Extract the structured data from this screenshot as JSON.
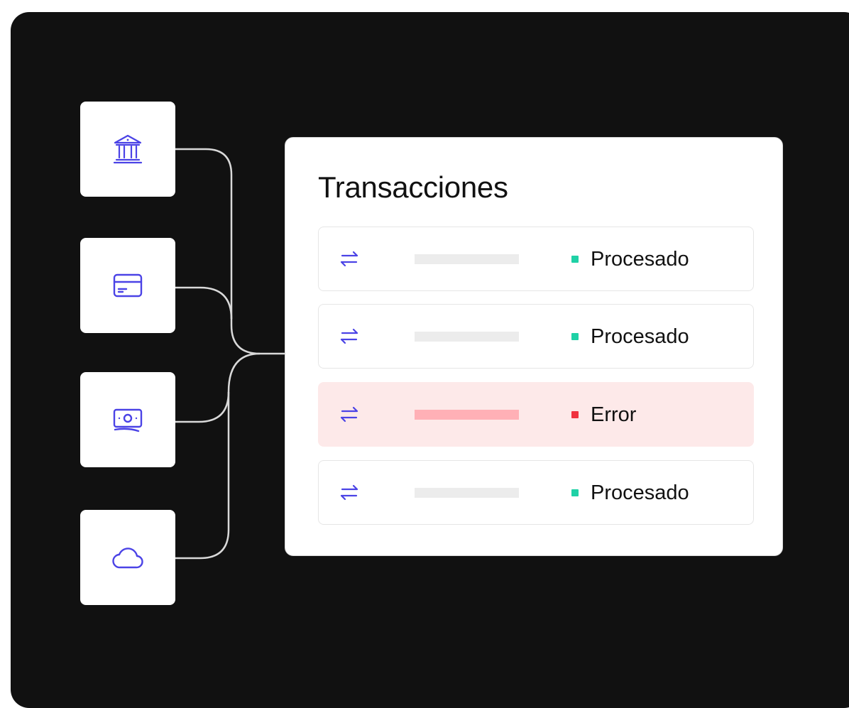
{
  "panel": {
    "title": "Transacciones"
  },
  "sources": [
    {
      "icon": "bank-icon"
    },
    {
      "icon": "credit-card-icon"
    },
    {
      "icon": "cash-icon"
    },
    {
      "icon": "cloud-icon"
    }
  ],
  "transactions": [
    {
      "icon": "transfer-arrows-icon",
      "status": "Procesado",
      "status_color": "#1fd1a6"
    },
    {
      "icon": "transfer-arrows-icon",
      "status": "Procesado",
      "status_color": "#1fd1a6"
    },
    {
      "icon": "transfer-arrows-icon",
      "status": "Error",
      "status_color": "#f0323f"
    },
    {
      "icon": "transfer-arrows-icon",
      "status": "Procesado",
      "status_color": "#1fd1a6"
    }
  ],
  "colors": {
    "accent": "#4b43e6",
    "background": "#111111",
    "connector": "#d9d9d9",
    "error_row": "#fde9e9",
    "error_bar": "#ffb0b6",
    "placeholder_bar": "#ececec"
  }
}
